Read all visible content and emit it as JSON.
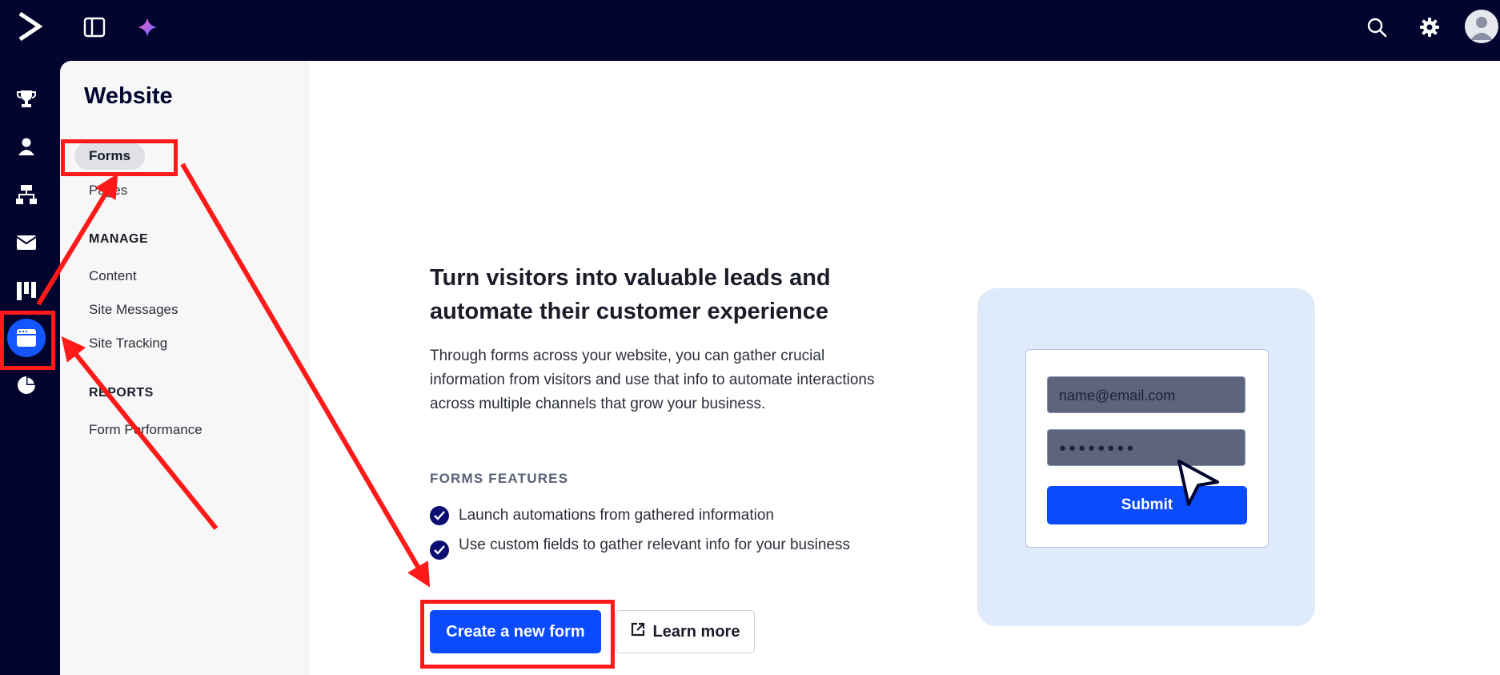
{
  "topbar": {
    "logo_icon": "activecampaign-logo-icon",
    "panel_icon": "sidebar-panel-icon",
    "ai_icon": "sparkle-icon",
    "search_icon": "search-icon",
    "settings_icon": "gear-icon",
    "avatar_icon": "user-avatar-icon"
  },
  "rail": {
    "items": [
      {
        "icon": "trophy-icon"
      },
      {
        "icon": "contacts-icon"
      },
      {
        "icon": "automations-icon"
      },
      {
        "icon": "email-icon"
      },
      {
        "icon": "pipelines-icon"
      },
      {
        "icon": "website-icon",
        "active": true
      },
      {
        "icon": "reports-icon"
      }
    ]
  },
  "subnav": {
    "title": "Website",
    "links": [
      "Forms",
      "Pages"
    ],
    "manage_heading": "MANAGE",
    "manage_links": [
      "Content",
      "Site Messages",
      "Site Tracking"
    ],
    "reports_heading": "REPORTS",
    "reports_links": [
      "Form Performance"
    ]
  },
  "main": {
    "heading": "Turn visitors into valuable leads and automate their customer experience",
    "intro": "Through forms across your website, you can gather crucial information from visitors and use that info to automate interactions across multiple channels that grow your business.",
    "features_heading": "FORMS FEATURES",
    "features": [
      "Launch automations from gathered information",
      "Use custom fields to gather relevant info for your business"
    ],
    "create_button": "Create a new form",
    "learn_more_button": "Learn more"
  },
  "illustration": {
    "email_placeholder": "name@email.com",
    "password_dots": "●●●●●●●●",
    "submit_label": "Submit"
  },
  "colors": {
    "nav_bg": "#03052e",
    "primary": "#0a4bff",
    "annotation": "#ff1a1a",
    "illustration_bg": "#dfeafa"
  }
}
